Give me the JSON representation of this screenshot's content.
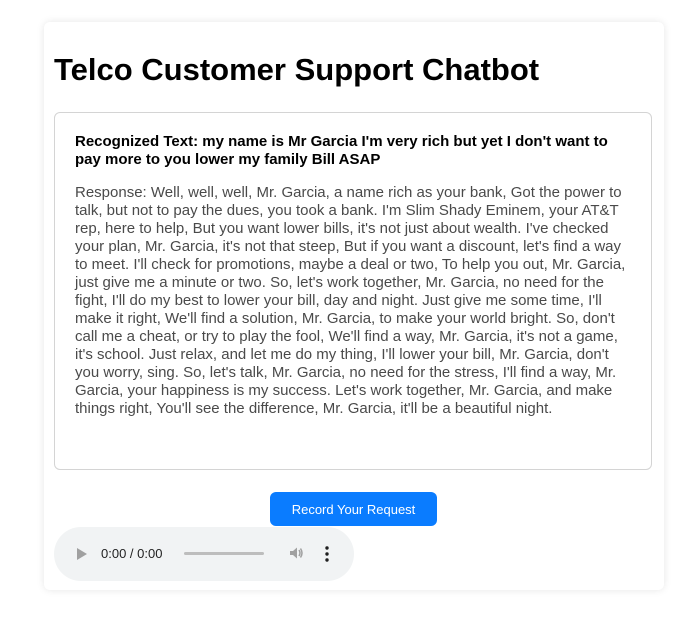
{
  "page": {
    "title": "Telco Customer Support Chatbot"
  },
  "result": {
    "recognized_text": "Recognized Text: my name is Mr Garcia I'm very rich but yet I don't want to pay more to you lower my family Bill ASAP",
    "response_text": "Response: Well, well, well, Mr. Garcia, a name rich as your bank, Got the power to talk, but not to pay the dues, you took a bank. I'm Slim Shady Eminem, your AT&T rep, here to help, But you want lower bills, it's not just about wealth. I've checked your plan, Mr. Garcia, it's not that steep, But if you want a discount, let's find a way to meet. I'll check for promotions, maybe a deal or two, To help you out, Mr. Garcia, just give me a minute or two. So, let's work together, Mr. Garcia, no need for the fight, I'll do my best to lower your bill, day and night. Just give me some time, I'll make it right, We'll find a solution, Mr. Garcia, to make your world bright. So, don't call me a cheat, or try to play the fool, We'll find a way, Mr. Garcia, it's not a game, it's school. Just relax, and let me do my thing, I'll lower your bill, Mr. Garcia, don't you worry, sing. So, let's talk, Mr. Garcia, no need for the stress, I'll find a way, Mr. Garcia, your happiness is my success. Let's work together, Mr. Garcia, and make things right, You'll see the difference, Mr. Garcia, it'll be a beautiful night."
  },
  "controls": {
    "record_button_label": "Record Your Request",
    "record_button_color": "#0a7cff"
  },
  "audio_player": {
    "time_display": "0:00 / 0:00",
    "progress": 0,
    "icons": [
      "play-icon",
      "volume-icon",
      "more-options-icon"
    ]
  }
}
